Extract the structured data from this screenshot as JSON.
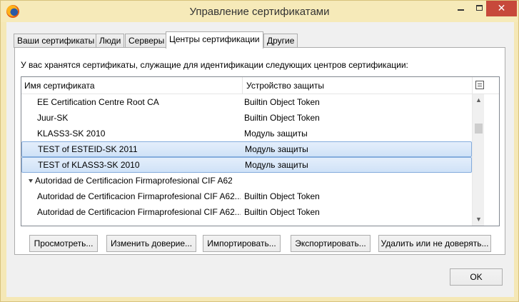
{
  "window": {
    "title": "Управление сертификатами",
    "close_glyph": "✕",
    "accent": "#f5e8b6",
    "close_color": "#c7493b"
  },
  "tabs": [
    {
      "label": "Ваши сертификаты",
      "active": false
    },
    {
      "label": "Люди",
      "active": false
    },
    {
      "label": "Серверы",
      "active": false
    },
    {
      "label": "Центры сертификации",
      "active": true
    },
    {
      "label": "Другие",
      "active": false
    }
  ],
  "panel": {
    "description": "У вас хранятся сертификаты, служащие для идентификации следующих центров сертификации:"
  },
  "tree": {
    "columns": [
      "Имя сертификата",
      "Устройство защиты"
    ],
    "rows": [
      {
        "name": "EE Certification Centre Root CA",
        "device": "Builtin Object Token",
        "selected": false,
        "group": false
      },
      {
        "name": "Juur-SK",
        "device": "Builtin Object Token",
        "selected": false,
        "group": false
      },
      {
        "name": "KLASS3-SK 2010",
        "device": "Модуль защиты",
        "selected": false,
        "group": false
      },
      {
        "name": "TEST of ESTEID-SK 2011",
        "device": "Модуль защиты",
        "selected": true,
        "group": false
      },
      {
        "name": "TEST of KLASS3-SK 2010",
        "device": "Модуль защиты",
        "selected": true,
        "group": false
      },
      {
        "name": "Autoridad de Certificacion Firmaprofesional CIF A6263...",
        "device": "",
        "selected": false,
        "group": true
      },
      {
        "name": "Autoridad de Certificacion Firmaprofesional CIF A62...",
        "device": "Builtin Object Token",
        "selected": false,
        "group": false
      },
      {
        "name": "Autoridad de Certificacion Firmaprofesional CIF A62...",
        "device": "Builtin Object Token",
        "selected": false,
        "group": false
      }
    ],
    "scroll_up_glyph": "▲",
    "scroll_down_glyph": "▼",
    "selection_color": "#cfe2f7"
  },
  "buttons": {
    "view": "Просмотреть...",
    "edit_trust": "Изменить доверие...",
    "import": "Импортировать...",
    "export": "Экспортировать...",
    "delete": "Удалить или не доверять..."
  },
  "ok_label": "OK"
}
